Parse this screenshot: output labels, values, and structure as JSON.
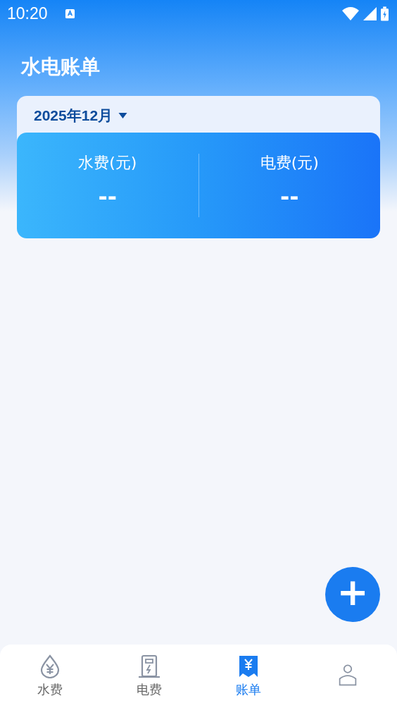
{
  "status_bar": {
    "time": "10:20"
  },
  "header": {
    "title": "水电账单"
  },
  "month_picker": {
    "label": "2025年12月"
  },
  "summary": [
    {
      "label": "水费(元)",
      "value": "--"
    },
    {
      "label": "电费(元)",
      "value": "--"
    }
  ],
  "add_button": {
    "label": "+"
  },
  "tabs": [
    {
      "kind": "water",
      "label": "水费",
      "selected": false
    },
    {
      "kind": "power",
      "label": "电费",
      "selected": false
    },
    {
      "kind": "bill",
      "label": "账单",
      "selected": true
    },
    {
      "kind": "profile",
      "selected": false
    }
  ]
}
